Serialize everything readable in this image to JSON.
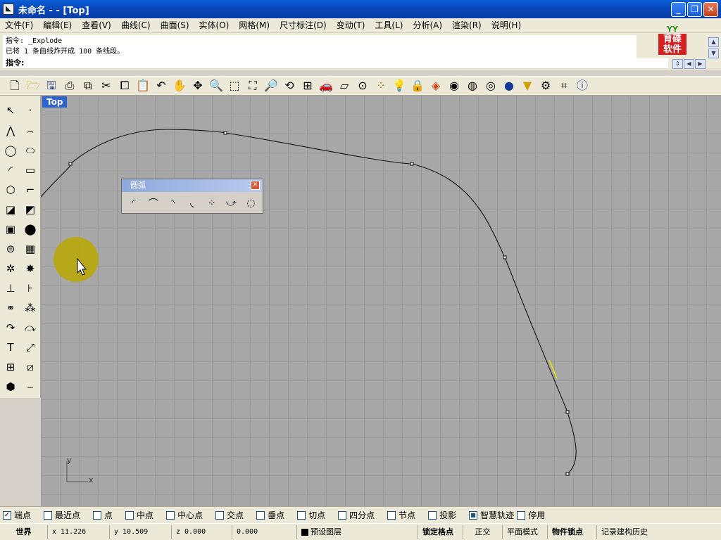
{
  "window": {
    "title": "未命名 -  - [Top]",
    "icon": "rhino-icon"
  },
  "menu": [
    "文件(F)",
    "编辑(E)",
    "查看(V)",
    "曲线(C)",
    "曲面(S)",
    "实体(O)",
    "网格(M)",
    "尺寸标注(D)",
    "变动(T)",
    "工具(L)",
    "分析(A)",
    "渲染(R)",
    "说明(H)"
  ],
  "command": {
    "history_line1": "指令: _Explode",
    "history_line2": "已将 1 条曲线炸开成 100 条线段。",
    "prompt": "指令:"
  },
  "logo": {
    "top": "YY",
    "line1": "育碟",
    "line2": "软件"
  },
  "viewport": {
    "label": "Top",
    "axis_y": "y",
    "axis_x": "x"
  },
  "arc_panel": {
    "title": "圆弧"
  },
  "snaps": [
    {
      "label": "端点",
      "checked": true
    },
    {
      "label": "最近点",
      "checked": false
    },
    {
      "label": "点",
      "checked": false
    },
    {
      "label": "中点",
      "checked": false
    },
    {
      "label": "中心点",
      "checked": false
    },
    {
      "label": "交点",
      "checked": false
    },
    {
      "label": "垂点",
      "checked": false
    },
    {
      "label": "切点",
      "checked": false
    },
    {
      "label": "四分点",
      "checked": false
    },
    {
      "label": "节点",
      "checked": false
    },
    {
      "label": "投影",
      "checked": false
    },
    {
      "label": "智慧轨迹",
      "checked": true
    },
    {
      "label": "停用",
      "checked": false
    }
  ],
  "status": {
    "world": "世界",
    "x": "x 11.226",
    "y": "y 10.509",
    "z": "z 0.000",
    "dist": "0.000",
    "layer": "预设图层",
    "grid_snap": "锁定格点",
    "ortho": "正交",
    "planar": "平面模式",
    "osnap": "物件锁点",
    "history": "记录建构历史"
  }
}
